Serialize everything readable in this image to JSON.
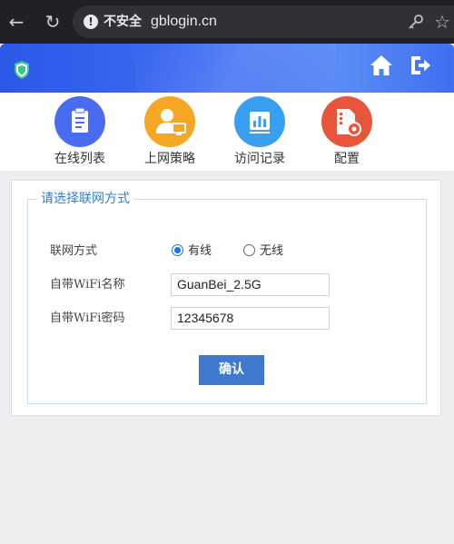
{
  "browser": {
    "security_label": "不安全",
    "url": "gblogin.cn"
  },
  "nav": {
    "items": [
      {
        "label": "在线列表",
        "icon": "clipboard-icon",
        "color": "#4a6cf0"
      },
      {
        "label": "上网策略",
        "icon": "user-computer-icon",
        "color": "#f5a623"
      },
      {
        "label": "访问记录",
        "icon": "bar-chart-icon",
        "color": "#3a9ff0"
      },
      {
        "label": "配置",
        "icon": "settings-file-icon",
        "color": "#e8553b"
      }
    ]
  },
  "form": {
    "legend": "请选择联网方式",
    "connection_label": "联网方式",
    "options": [
      {
        "label": "有线",
        "checked": true
      },
      {
        "label": "无线",
        "checked": false
      }
    ],
    "wifi_name_label": "自带WiFi名称",
    "wifi_name_value": "GuanBei_2.5G",
    "wifi_password_label": "自带WiFi密码",
    "wifi_password_value": "12345678",
    "confirm_label": "确认"
  },
  "colors": {
    "header_blue": "#3e6cf2",
    "legend_blue": "#2f7fd6",
    "button_blue": "#3f7ad0"
  }
}
